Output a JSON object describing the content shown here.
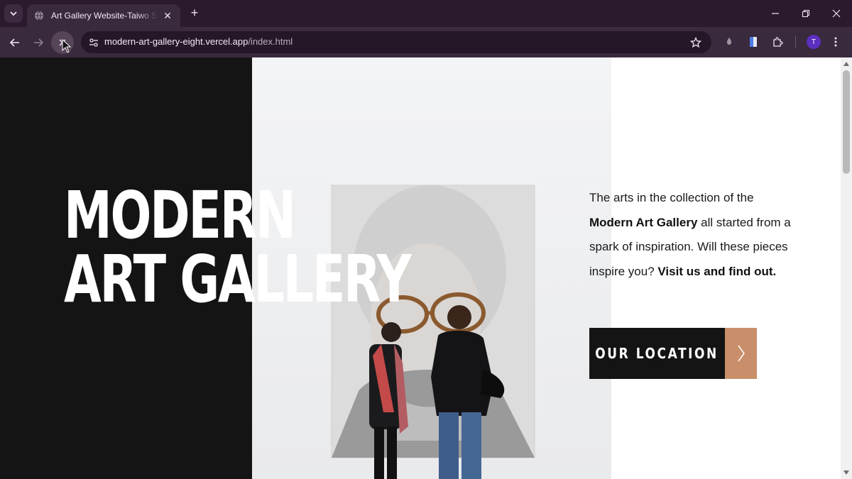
{
  "browser": {
    "tab": {
      "title": "Art Gallery Website-Taiwo Sharon",
      "favicon": "globe-icon"
    },
    "url": {
      "host": "modern-art-gallery-eight.vercel.app",
      "path": "/index.html"
    },
    "profile_initial": "T"
  },
  "hero": {
    "title_line1": "MODERN",
    "title_line2": "ART GALLERY"
  },
  "intro": {
    "text_1": "The arts in the collection of the ",
    "strong_1": "Modern Art Gallery",
    "text_2": " all started from a spark of inspiration. Will these pieces inspire you? ",
    "strong_2": "Visit us and find out."
  },
  "cta": {
    "label": "OUR LOCATION",
    "arrow_icon": "chevron-right-icon"
  },
  "colors": {
    "accent": "#c98f6a",
    "dark_panel": "#141414",
    "chrome_bg": "#2b1a2e"
  }
}
